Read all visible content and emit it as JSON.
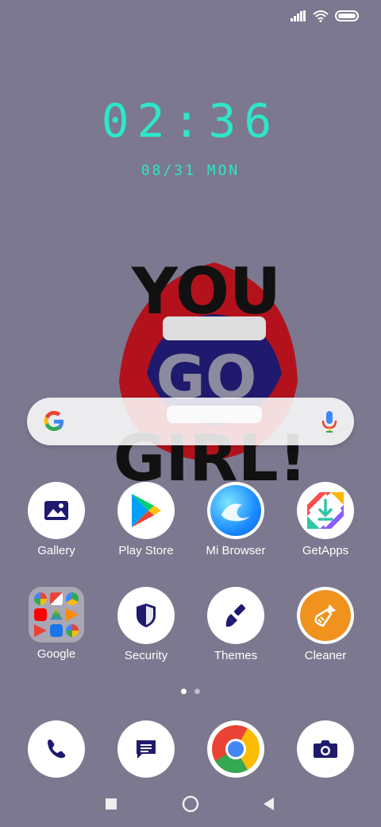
{
  "clock": {
    "time": "02:36",
    "date": "08/31 MON"
  },
  "wallpaper": {
    "line1": "YOU",
    "line2": "GO",
    "line3": "GIRL!"
  },
  "search": {
    "placeholder": ""
  },
  "apps_row1": [
    {
      "label": "Gallery",
      "icon": "gallery-icon"
    },
    {
      "label": "Play Store",
      "icon": "play-store-icon"
    },
    {
      "label": "Mi Browser",
      "icon": "mi-browser-icon"
    },
    {
      "label": "GetApps",
      "icon": "getapps-icon"
    }
  ],
  "apps_row2": [
    {
      "label": "Google",
      "icon": "google-folder-icon"
    },
    {
      "label": "Security",
      "icon": "shield-icon"
    },
    {
      "label": "Themes",
      "icon": "brush-icon"
    },
    {
      "label": "Cleaner",
      "icon": "broom-icon"
    }
  ],
  "dock": [
    {
      "icon": "phone-icon"
    },
    {
      "icon": "messages-icon"
    },
    {
      "icon": "chrome-icon"
    },
    {
      "icon": "camera-icon"
    }
  ],
  "pages": {
    "count": 2,
    "active": 0
  },
  "colors": {
    "accent": "#2ee6c9",
    "background": "#7b788f",
    "icon_blue": "#1f1a6e"
  }
}
